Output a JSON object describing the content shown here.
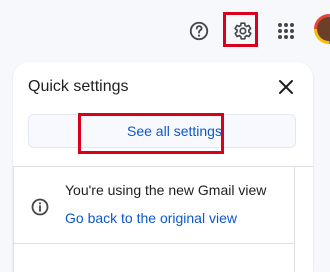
{
  "topbar": {
    "help_icon": "help-icon",
    "settings_icon": "gear-icon",
    "apps_icon": "apps-grid-icon",
    "avatar": "profile-avatar"
  },
  "quick_settings": {
    "title": "Quick settings",
    "close_icon": "close-icon",
    "see_all_label": "See all settings",
    "info": {
      "icon": "info-icon",
      "text": "You're using the new Gmail view",
      "link": "Go back to the original view"
    }
  },
  "colors": {
    "highlight": "#d9001b",
    "link_blue": "#0b57d0",
    "panel_bg": "#ffffff",
    "page_bg": "#f6f8fc"
  }
}
